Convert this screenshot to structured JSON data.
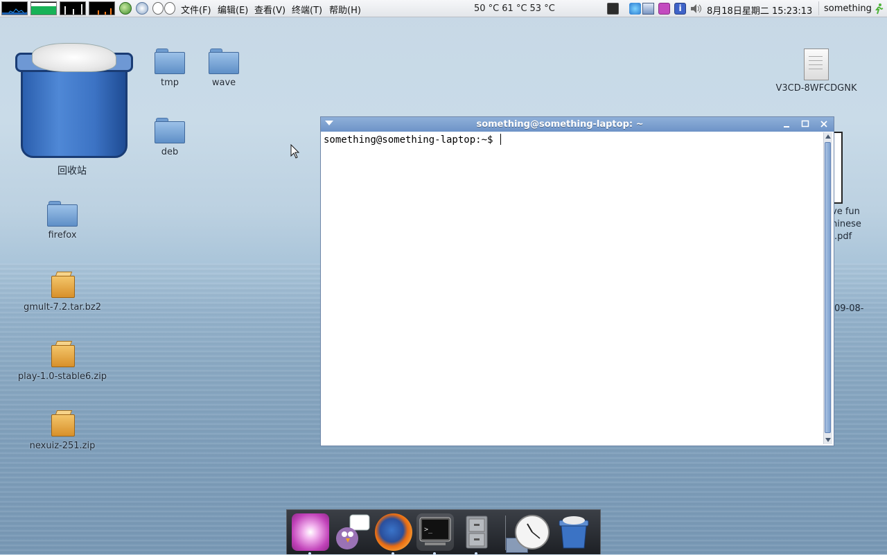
{
  "panel": {
    "menus": [
      "文件(F)",
      "编辑(E)",
      "查看(V)",
      "终端(T)",
      "帮助(H)"
    ],
    "temps": [
      "50 °C",
      "61 °C",
      "53 °C"
    ],
    "clock": "8月18日星期二 15:23:13",
    "user": "something"
  },
  "desktop": {
    "trash_label": "回收站",
    "icons": {
      "tmp": "tmp",
      "wave": "wave",
      "deb": "deb",
      "firefox": "firefox",
      "gmult": "gmult-7.2.tar.bz2",
      "play": "play-1.0-stable6.zip",
      "nexuiz": "nexuiz-251.zip",
      "v3cd": "V3CD-8WFCDGNK"
    },
    "partial_text": {
      "line1": "ve fun",
      "line2": "hinese",
      "line3": ".pdf",
      "line4": "09-08-"
    }
  },
  "terminal": {
    "title": "something@something-laptop: ~",
    "prompt": "something@something-laptop:~$ "
  },
  "dock": {
    "items": [
      "settings-icon",
      "pidgin-icon",
      "firefox-icon",
      "terminal-icon",
      "file-cabinet-icon",
      "clock-icon",
      "trash-icon"
    ]
  },
  "colors": {
    "title_bar": "#7ea2d2",
    "dock_bg": "#2a2d33",
    "folder": "#6f9cd0"
  }
}
